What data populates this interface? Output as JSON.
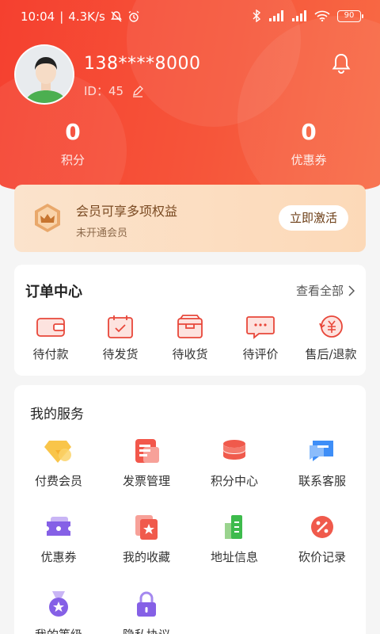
{
  "status_bar": {
    "time": "10:04",
    "speed": "4.3K/s",
    "battery": "90"
  },
  "profile": {
    "phone": "138****8000",
    "id_label": "ID：45"
  },
  "stats": [
    {
      "value": "0",
      "label": "积分"
    },
    {
      "value": "0",
      "label": "优惠券"
    }
  ],
  "member": {
    "title": "会员可享多项权益",
    "subtitle": "未开通会员",
    "button": "立即激活"
  },
  "orders": {
    "title": "订单中心",
    "view_all": "查看全部",
    "items": [
      {
        "label": "待付款",
        "icon": "wallet-icon"
      },
      {
        "label": "待发货",
        "icon": "calendar-check-icon"
      },
      {
        "label": "待收货",
        "icon": "box-icon"
      },
      {
        "label": "待评价",
        "icon": "chat-bubble-icon"
      },
      {
        "label": "售后/退款",
        "icon": "refund-icon"
      }
    ]
  },
  "services": {
    "title": "我的服务",
    "items": [
      {
        "label": "付费会员",
        "icon": "diamond-icon"
      },
      {
        "label": "发票管理",
        "icon": "invoice-icon"
      },
      {
        "label": "积分中心",
        "icon": "coin-stack-icon"
      },
      {
        "label": "联系客服",
        "icon": "chat-icon"
      },
      {
        "label": "优惠券",
        "icon": "ticket-icon"
      },
      {
        "label": "我的收藏",
        "icon": "star-card-icon"
      },
      {
        "label": "地址信息",
        "icon": "building-icon"
      },
      {
        "label": "砍价记录",
        "icon": "discount-icon"
      },
      {
        "label": "我的等级",
        "icon": "medal-icon"
      },
      {
        "label": "隐私协议",
        "icon": "lock-icon"
      }
    ]
  },
  "colors": {
    "brand": "#f5402f",
    "accent_red": "#e8473a",
    "gold": "#d9893f"
  }
}
